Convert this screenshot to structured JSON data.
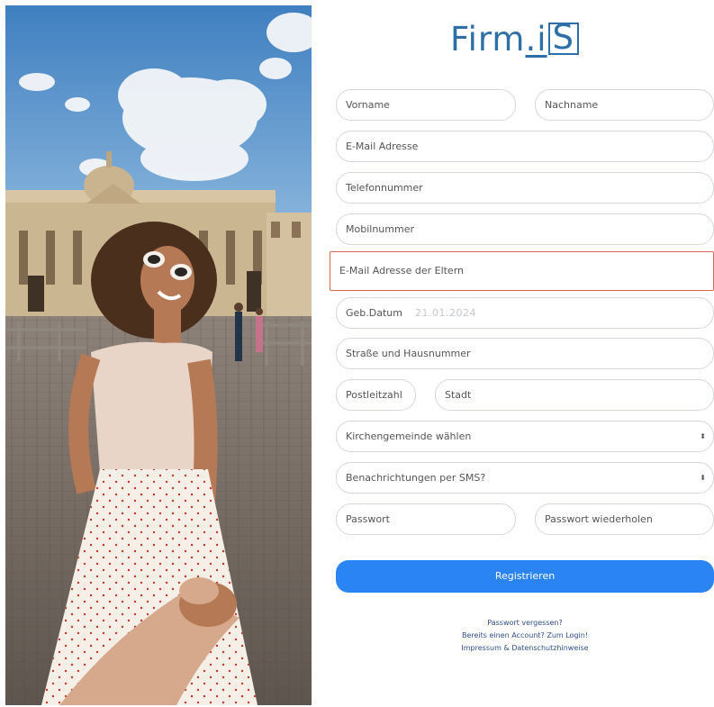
{
  "logo": {
    "text_main": "Firm",
    "text_dot": ".i",
    "text_box": "S"
  },
  "form": {
    "first_name": "Vorname",
    "last_name": "Nachname",
    "email": "E-Mail Adresse",
    "phone": "Telefonnummer",
    "mobile": "Mobilnummer",
    "parent_email": "E-Mail Adresse der Eltern",
    "birthdate_label": "Geb.Datum",
    "birthdate_value": "21.01.2024",
    "street": "Straße und Hausnummer",
    "zip": "Postleitzahl",
    "city": "Stadt",
    "parish_select": "Kirchengemeinde wählen",
    "sms_select": "Benachrichtungen per SMS?",
    "password": "Passwort",
    "password_repeat": "Passwort wiederholen",
    "select_caret": "⬍"
  },
  "button": {
    "register": "Registrieren"
  },
  "links": {
    "forgot_password": "Passwort vergessen?",
    "login": "Bereits einen Account? Zum Login!",
    "imprint": "Impressum & Datenschutzhinweise"
  },
  "colors": {
    "brand": "#2f6fa8",
    "button": "#2a84f3",
    "highlight_border": "#d5665a",
    "field_border": "#d4d7dc"
  }
}
